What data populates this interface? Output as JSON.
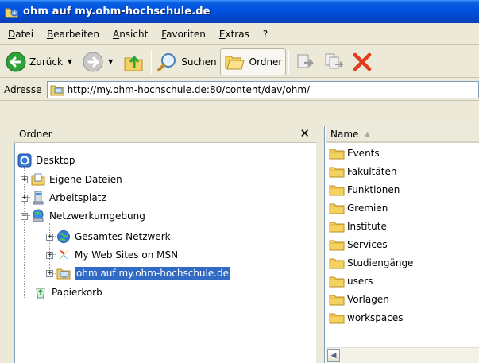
{
  "window": {
    "title": "ohm auf my.ohm-hochschule.de"
  },
  "menu": {
    "items": [
      "Datei",
      "Bearbeiten",
      "Ansicht",
      "Favoriten",
      "Extras",
      "?"
    ]
  },
  "toolbar": {
    "back_label": "Zurück",
    "search_label": "Suchen",
    "folders_label": "Ordner"
  },
  "address": {
    "label": "Adresse",
    "value": "http://my.ohm-hochschule.de:80/content/dav/ohm/"
  },
  "folder_pane": {
    "title": "Ordner",
    "close": "✕",
    "tree": [
      {
        "label": "Desktop",
        "icon": "desktop-icon"
      },
      {
        "label": "Eigene Dateien",
        "icon": "my-documents-icon"
      },
      {
        "label": "Arbeitsplatz",
        "icon": "my-computer-icon"
      },
      {
        "label": "Netzwerkumgebung",
        "icon": "network-places-icon"
      },
      {
        "label": "Gesamtes Netzwerk",
        "icon": "entire-network-icon"
      },
      {
        "label": "My Web Sites on MSN",
        "icon": "msn-icon"
      },
      {
        "label": "ohm auf my.ohm-hochschule.de",
        "icon": "web-folder-icon",
        "selected": true
      },
      {
        "label": "Papierkorb",
        "icon": "recycle-bin-icon"
      }
    ]
  },
  "list_pane": {
    "column_name": "Name",
    "sort_indicator": "▲",
    "items": [
      "Events",
      "Fakultäten",
      "Funktionen",
      "Gremien",
      "Institute",
      "Services",
      "Studiengänge",
      "users",
      "Vorlagen",
      "workspaces"
    ]
  },
  "scrollbar": {
    "left_arrow": "◀"
  },
  "colors": {
    "titlebar": "#0053e1",
    "selection": "#316ac5",
    "folder": "#f5d160"
  }
}
